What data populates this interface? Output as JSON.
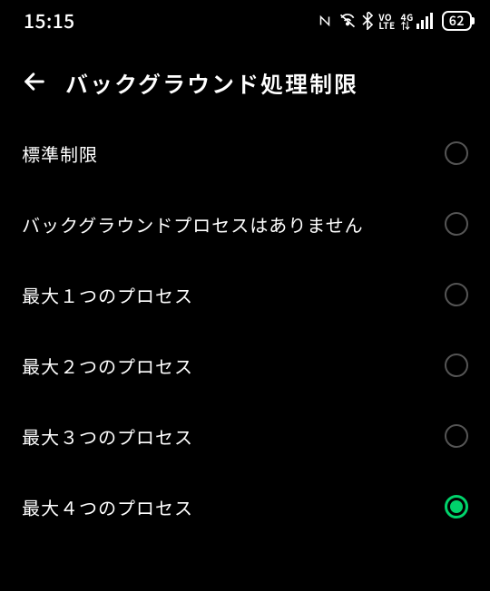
{
  "status": {
    "time": "15:15",
    "battery": "62"
  },
  "header": {
    "title": "バックグラウンド処理制限"
  },
  "options": [
    {
      "label": "標準制限",
      "selected": false
    },
    {
      "label": "バックグラウンドプロセスはありません",
      "selected": false
    },
    {
      "label": "最大１つのプロセス",
      "selected": false
    },
    {
      "label": "最大２つのプロセス",
      "selected": false
    },
    {
      "label": "最大３つのプロセス",
      "selected": false
    },
    {
      "label": "最大４つのプロセス",
      "selected": true
    }
  ]
}
